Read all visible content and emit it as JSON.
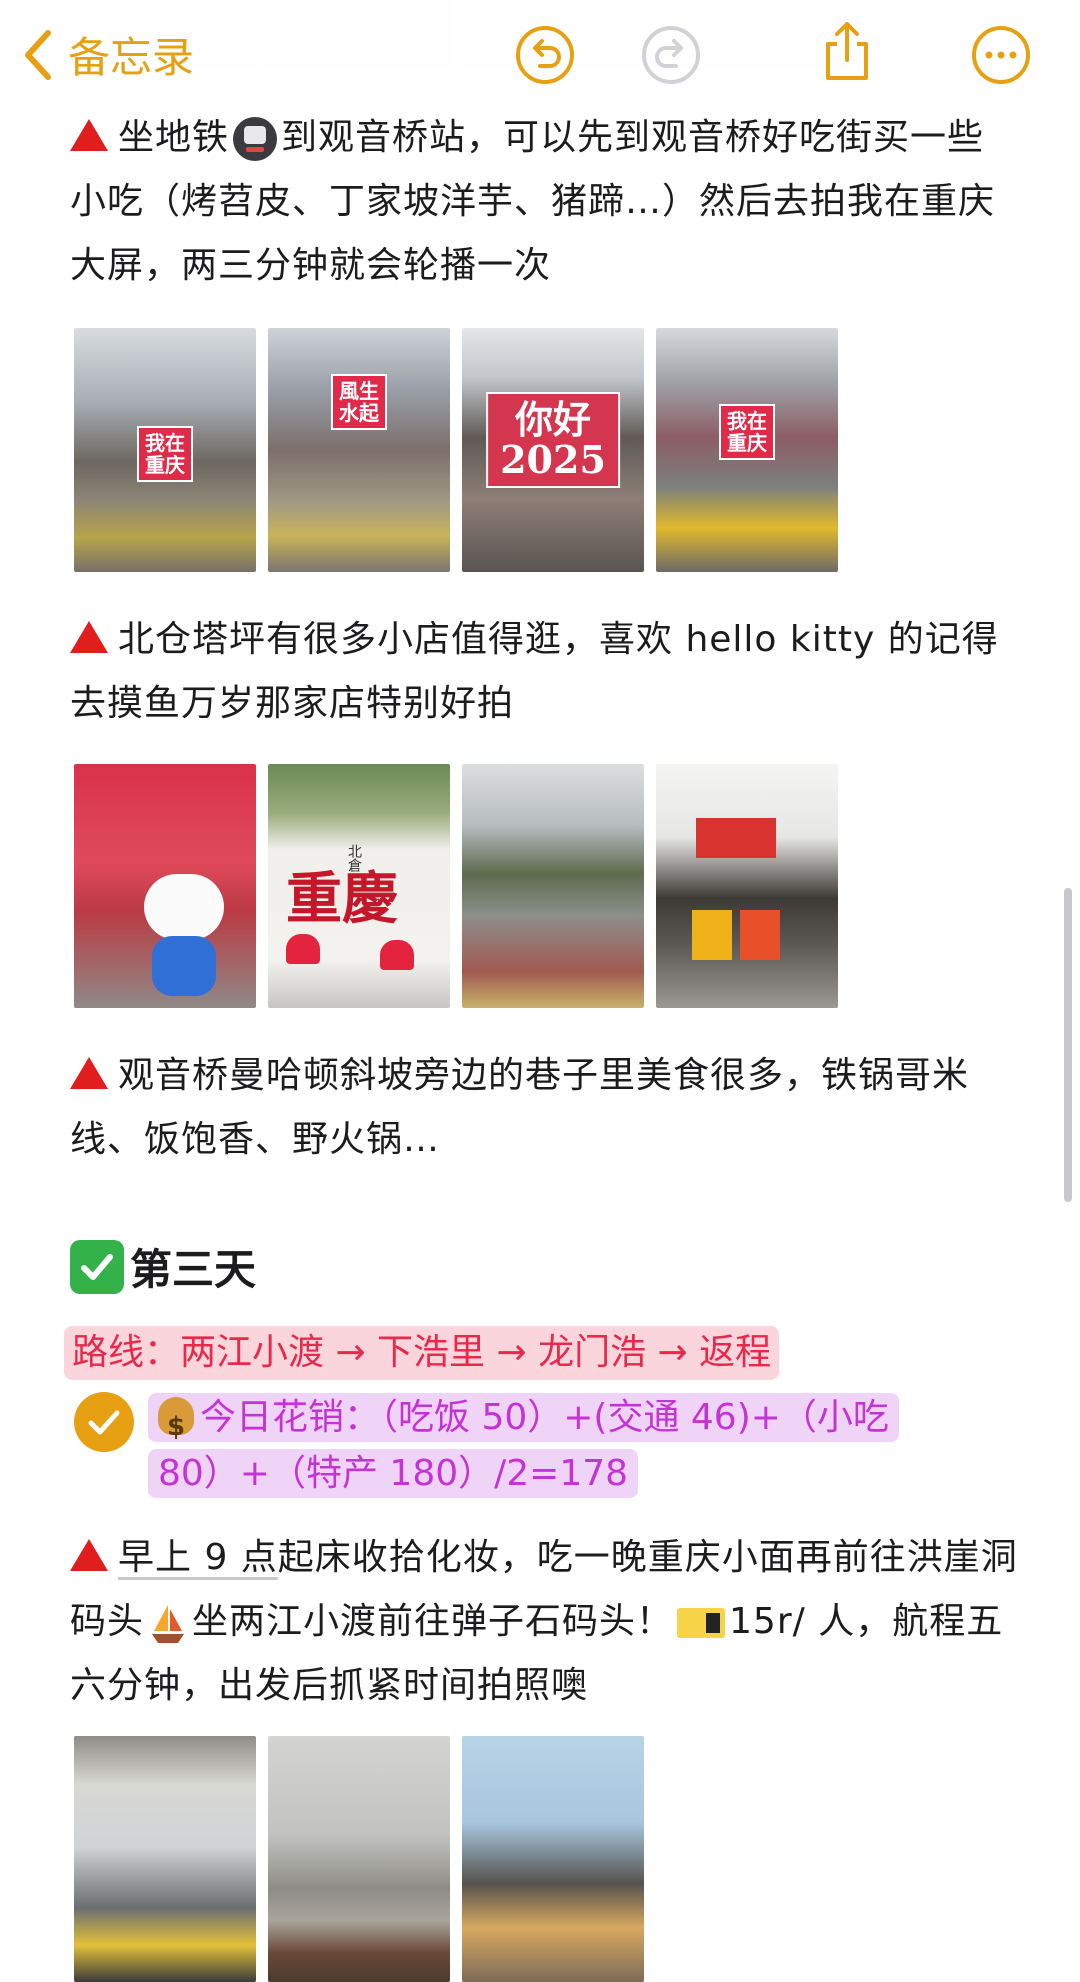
{
  "nav": {
    "back_label": "备忘录"
  },
  "sections": {
    "p1": {
      "pre": "坐地铁",
      "post": "到观音桥站，可以先到观音桥好吃街买一些小吃（烤苕皮、丁家坡洋芋、猪蹄…）然后去拍我在重庆大屏，两三分钟就会轮播一次"
    },
    "photos1": {
      "sign1": "我在\n重庆",
      "sign2": "風生\n水起",
      "sign3": "你好\n2025",
      "sign4": "我在\n重庆"
    },
    "p2": {
      "text": "北仓塔坪有很多小店值得逛，喜欢 hello kitty 的记得去摸鱼万岁那家店特别好拍"
    },
    "photos2": {
      "wall_big": "重慶",
      "wall_small": "北倉"
    },
    "p3": {
      "text": "观音桥曼哈顿斜坡旁边的巷子里美食很多，铁锅哥米线、饭饱香、野火锅…"
    },
    "day3": {
      "title": "第三天"
    },
    "route": {
      "text": "路线：两江小渡 → 下浩里 → 龙门浩 → 返程"
    },
    "cost": {
      "text": "今日花销：（吃饭 50）+(交通 46)+（小吃 80）+（特产 180）/2=178"
    },
    "p4": {
      "underlined": "早上 9 点",
      "a": "起床收拾化妆，吃一晚重庆小面再前往洪崖洞码头",
      "b": "坐两江小渡前往弹子石码头！",
      "c": "15r/ 人，航程五六分钟，出发后抓紧时间拍照噢"
    }
  },
  "colors": {
    "accent": "#e6a012",
    "route_text": "#e8294b",
    "cost_text": "#c433d6",
    "triangle": "#e01e1e"
  }
}
